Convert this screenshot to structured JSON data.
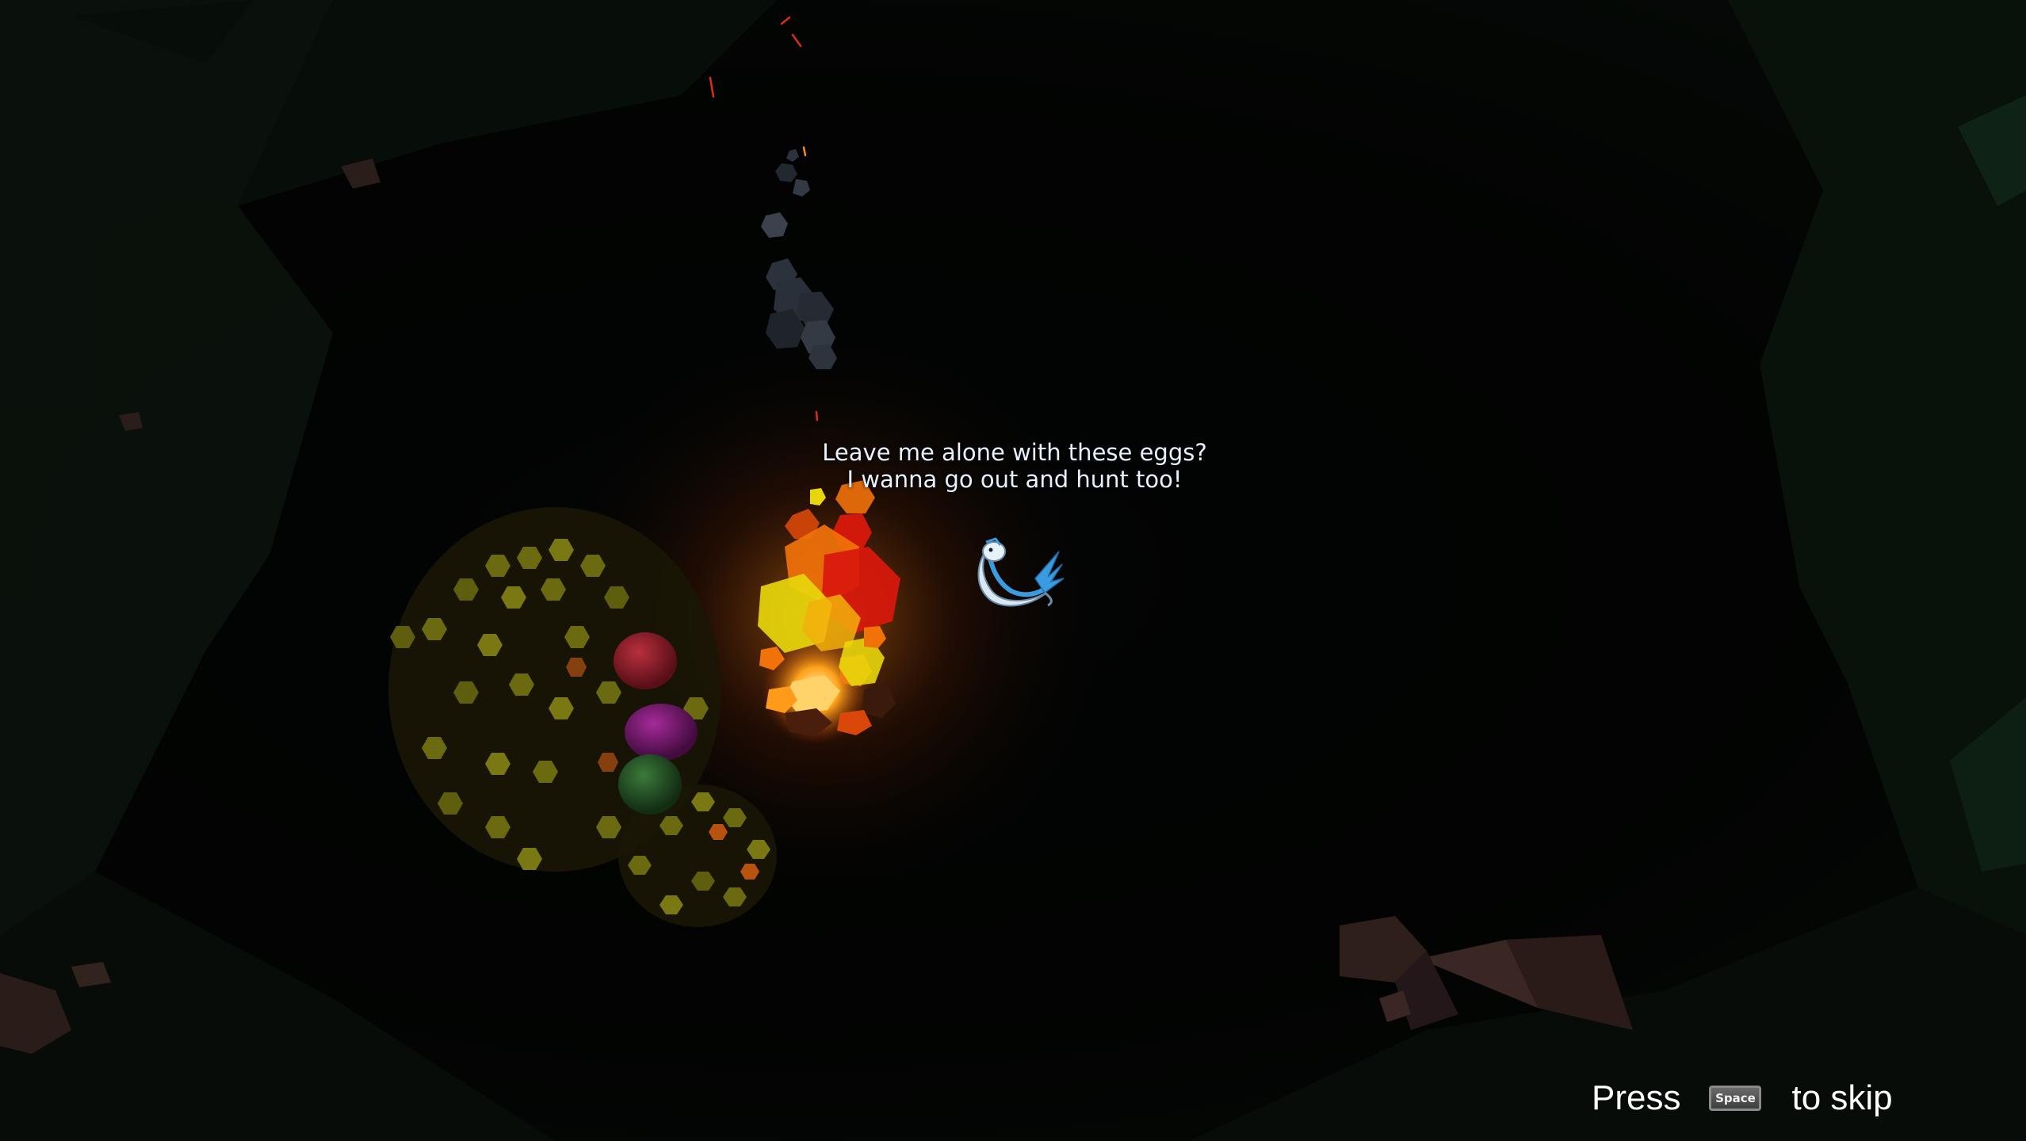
{
  "dialogue": {
    "text": "Leave me alone with these eggs? I wanna go out and hunt too!"
  },
  "skip_hint": {
    "press": "Press",
    "key": "Space",
    "suffix": "to skip"
  },
  "character": {
    "name": "serpent-dragon"
  },
  "eggs": [
    {
      "color": "#7a1826"
    },
    {
      "color": "#6a1466"
    },
    {
      "color": "#1f4a23"
    }
  ],
  "colors": {
    "dialogue_text": "#e8f2ff",
    "fire_red": "#d9180c",
    "fire_orange": "#f2720a",
    "fire_yellow": "#e8d60c",
    "foliage": "#6b6a10",
    "rock": "#3a2622",
    "character_blue": "#3a9be0"
  }
}
